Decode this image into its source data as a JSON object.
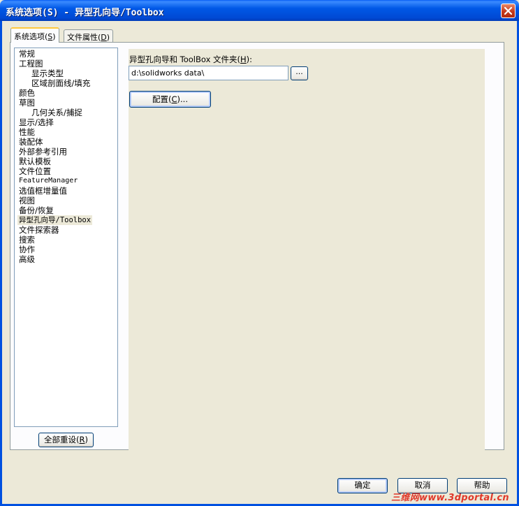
{
  "window": {
    "title": "系统选项(S) - 异型孔向导/Toolbox"
  },
  "tabs": [
    {
      "label": "系统选项(",
      "mnemonic": "S",
      "suffix": ")",
      "active": true
    },
    {
      "label": "文件属性(",
      "mnemonic": "D",
      "suffix": ")",
      "active": false
    }
  ],
  "tree": {
    "items": [
      {
        "label": "常规",
        "level": 0
      },
      {
        "label": "工程图",
        "level": 0
      },
      {
        "label": "显示类型",
        "level": 1
      },
      {
        "label": "区域剖面线/填充",
        "level": 1
      },
      {
        "label": "颜色",
        "level": 0
      },
      {
        "label": "草图",
        "level": 0
      },
      {
        "label": "几何关系/捕捉",
        "level": 1
      },
      {
        "label": "显示/选择",
        "level": 0
      },
      {
        "label": "性能",
        "level": 0
      },
      {
        "label": "装配体",
        "level": 0
      },
      {
        "label": "外部参考引用",
        "level": 0
      },
      {
        "label": "默认模板",
        "level": 0
      },
      {
        "label": "文件位置",
        "level": 0
      },
      {
        "label": "FeatureManager",
        "level": 0
      },
      {
        "label": "选值框增量值",
        "level": 0
      },
      {
        "label": "视图",
        "level": 0
      },
      {
        "label": "备份/恢复",
        "level": 0
      },
      {
        "label": "异型孔向导/Toolbox",
        "level": 0,
        "selected": true
      },
      {
        "label": "文件探索器",
        "level": 0
      },
      {
        "label": "搜索",
        "level": 0
      },
      {
        "label": "协作",
        "level": 0
      },
      {
        "label": "高级",
        "level": 0
      }
    ]
  },
  "reset_button": {
    "label": "全部重设(",
    "mnemonic": "R",
    "suffix": ")"
  },
  "toolbox": {
    "folder_label": "异型孔向导和 ToolBox 文件夹(",
    "folder_mnemonic": "H",
    "folder_suffix": "):",
    "folder_value": "d:\\solidworks data\\",
    "browse_label": "...",
    "configure_label": "配置(",
    "configure_mnemonic": "C",
    "configure_suffix": ")..."
  },
  "footer": {
    "ok_label": "确定",
    "cancel_label": "取消",
    "help_label": "帮助"
  },
  "watermark": "三维网www.3dportal.cn",
  "colors": {
    "titlebar": "#0058e6",
    "dialog_bg": "#ece9d8",
    "active_tab_accent": "#ffc83c",
    "close_button": "#c4391c",
    "watermark": "#e0382a"
  }
}
